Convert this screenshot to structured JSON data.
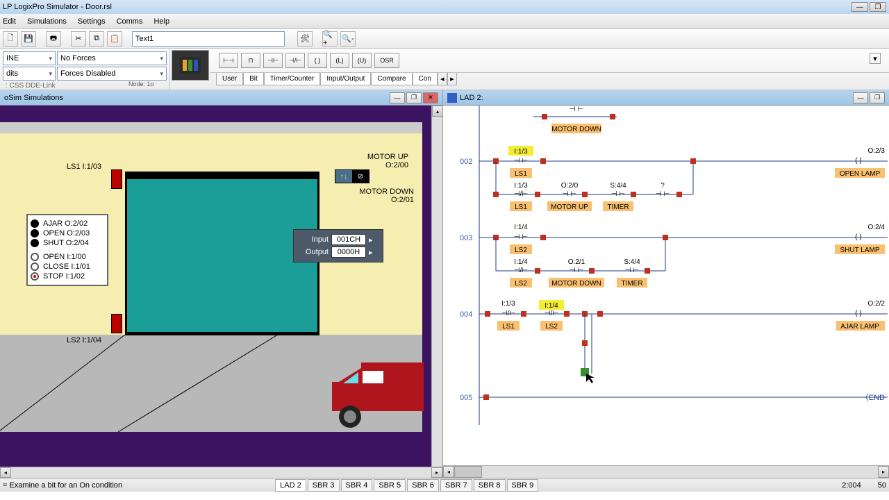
{
  "window": {
    "title": "LP LogixPro Simulator  -  Door.rsl"
  },
  "menu": {
    "edit": "Edit",
    "simulations": "Simulations",
    "settings": "Settings",
    "comms": "Comms",
    "help": "Help"
  },
  "toolbar": {
    "search": "Text1"
  },
  "controls": {
    "mode": "INE",
    "forces": "No Forces",
    "forces_state": "Forces Disabled",
    "edits": "dits",
    "status": ": CSS DDE-Link",
    "node": "Node: 1o"
  },
  "inst_tabs": {
    "user": "User",
    "bit": "Bit",
    "timer": "Timer/Counter",
    "io": "Input/Output",
    "compare": "Compare",
    "con": "Con"
  },
  "inst_btns": {
    "osr": "OSR"
  },
  "sim": {
    "title": "oSim Simulations",
    "ls1": "LS1   I:1/03",
    "ls2": "LS2   I:1/04",
    "motor_up": "MOTOR UP",
    "motor_up_addr": "O:2/00",
    "motor_down": "MOTOR DOWN",
    "motor_down_addr": "O:2/01",
    "status": {
      "ajar": "AJAR  O:2/02",
      "open": "OPEN  O:2/03",
      "shut": "SHUT  O:2/04",
      "b_open": "OPEN   I:1/00",
      "b_close": "CLOSE I:1/01",
      "b_stop": "STOP   I:1/02"
    },
    "io": {
      "input_lbl": "Input",
      "input_val": "001CH",
      "output_lbl": "Output",
      "output_val": "0000H"
    }
  },
  "lad": {
    "title": "LAD 2:",
    "rungs": {
      "r001_coil": "MOTOR DOWN",
      "r002": "002",
      "r002_coil": "OPEN LAMP",
      "r002_coil_addr": "O:2/3",
      "r003": "003",
      "r003_coil": "SHUT LAMP",
      "r003_coil_addr": "O:2/4",
      "r004": "004",
      "r004_coil": "AJAR LAMP",
      "r004_coil_addr": "O:2/2",
      "r005": "005",
      "r005_end": "END"
    },
    "tags": {
      "ls1": "LS1",
      "ls2": "LS2",
      "motor_up": "MOTOR UP",
      "motor_down": "MOTOR DOWN",
      "timer": "TIMER",
      "i13": "I:1/3",
      "i14": "I:1/4",
      "o20": "O:2/0",
      "o21": "O:2/1",
      "s44": "S:4/4",
      "q": "?"
    }
  },
  "bottom": {
    "msg": "= Examine a bit for an On condition",
    "tabs": {
      "lad2": "LAD 2",
      "sbr3": "SBR 3",
      "sbr4": "SBR 4",
      "sbr5": "SBR 5",
      "sbr6": "SBR 6",
      "sbr7": "SBR 7",
      "sbr8": "SBR 8",
      "sbr9": "SBR 9"
    },
    "pos": "2:004",
    "val": "50"
  }
}
